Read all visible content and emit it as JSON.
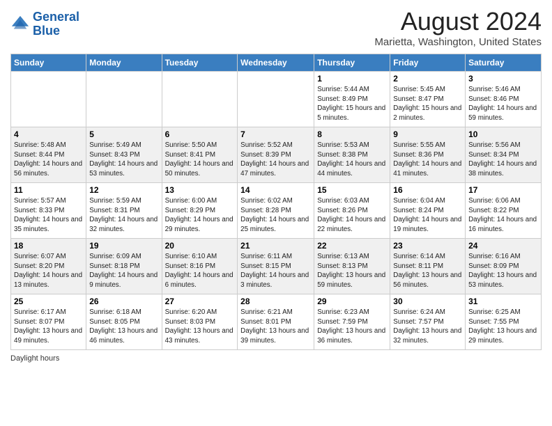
{
  "logo": {
    "line1": "General",
    "line2": "Blue"
  },
  "title": "August 2024",
  "subtitle": "Marietta, Washington, United States",
  "days_of_week": [
    "Sunday",
    "Monday",
    "Tuesday",
    "Wednesday",
    "Thursday",
    "Friday",
    "Saturday"
  ],
  "footer": "Daylight hours",
  "weeks": [
    [
      {
        "day": "",
        "info": ""
      },
      {
        "day": "",
        "info": ""
      },
      {
        "day": "",
        "info": ""
      },
      {
        "day": "",
        "info": ""
      },
      {
        "day": "1",
        "info": "Sunrise: 5:44 AM\nSunset: 8:49 PM\nDaylight: 15 hours and 5 minutes."
      },
      {
        "day": "2",
        "info": "Sunrise: 5:45 AM\nSunset: 8:47 PM\nDaylight: 15 hours and 2 minutes."
      },
      {
        "day": "3",
        "info": "Sunrise: 5:46 AM\nSunset: 8:46 PM\nDaylight: 14 hours and 59 minutes."
      }
    ],
    [
      {
        "day": "4",
        "info": "Sunrise: 5:48 AM\nSunset: 8:44 PM\nDaylight: 14 hours and 56 minutes."
      },
      {
        "day": "5",
        "info": "Sunrise: 5:49 AM\nSunset: 8:43 PM\nDaylight: 14 hours and 53 minutes."
      },
      {
        "day": "6",
        "info": "Sunrise: 5:50 AM\nSunset: 8:41 PM\nDaylight: 14 hours and 50 minutes."
      },
      {
        "day": "7",
        "info": "Sunrise: 5:52 AM\nSunset: 8:39 PM\nDaylight: 14 hours and 47 minutes."
      },
      {
        "day": "8",
        "info": "Sunrise: 5:53 AM\nSunset: 8:38 PM\nDaylight: 14 hours and 44 minutes."
      },
      {
        "day": "9",
        "info": "Sunrise: 5:55 AM\nSunset: 8:36 PM\nDaylight: 14 hours and 41 minutes."
      },
      {
        "day": "10",
        "info": "Sunrise: 5:56 AM\nSunset: 8:34 PM\nDaylight: 14 hours and 38 minutes."
      }
    ],
    [
      {
        "day": "11",
        "info": "Sunrise: 5:57 AM\nSunset: 8:33 PM\nDaylight: 14 hours and 35 minutes."
      },
      {
        "day": "12",
        "info": "Sunrise: 5:59 AM\nSunset: 8:31 PM\nDaylight: 14 hours and 32 minutes."
      },
      {
        "day": "13",
        "info": "Sunrise: 6:00 AM\nSunset: 8:29 PM\nDaylight: 14 hours and 29 minutes."
      },
      {
        "day": "14",
        "info": "Sunrise: 6:02 AM\nSunset: 8:28 PM\nDaylight: 14 hours and 25 minutes."
      },
      {
        "day": "15",
        "info": "Sunrise: 6:03 AM\nSunset: 8:26 PM\nDaylight: 14 hours and 22 minutes."
      },
      {
        "day": "16",
        "info": "Sunrise: 6:04 AM\nSunset: 8:24 PM\nDaylight: 14 hours and 19 minutes."
      },
      {
        "day": "17",
        "info": "Sunrise: 6:06 AM\nSunset: 8:22 PM\nDaylight: 14 hours and 16 minutes."
      }
    ],
    [
      {
        "day": "18",
        "info": "Sunrise: 6:07 AM\nSunset: 8:20 PM\nDaylight: 14 hours and 13 minutes."
      },
      {
        "day": "19",
        "info": "Sunrise: 6:09 AM\nSunset: 8:18 PM\nDaylight: 14 hours and 9 minutes."
      },
      {
        "day": "20",
        "info": "Sunrise: 6:10 AM\nSunset: 8:16 PM\nDaylight: 14 hours and 6 minutes."
      },
      {
        "day": "21",
        "info": "Sunrise: 6:11 AM\nSunset: 8:15 PM\nDaylight: 14 hours and 3 minutes."
      },
      {
        "day": "22",
        "info": "Sunrise: 6:13 AM\nSunset: 8:13 PM\nDaylight: 13 hours and 59 minutes."
      },
      {
        "day": "23",
        "info": "Sunrise: 6:14 AM\nSunset: 8:11 PM\nDaylight: 13 hours and 56 minutes."
      },
      {
        "day": "24",
        "info": "Sunrise: 6:16 AM\nSunset: 8:09 PM\nDaylight: 13 hours and 53 minutes."
      }
    ],
    [
      {
        "day": "25",
        "info": "Sunrise: 6:17 AM\nSunset: 8:07 PM\nDaylight: 13 hours and 49 minutes."
      },
      {
        "day": "26",
        "info": "Sunrise: 6:18 AM\nSunset: 8:05 PM\nDaylight: 13 hours and 46 minutes."
      },
      {
        "day": "27",
        "info": "Sunrise: 6:20 AM\nSunset: 8:03 PM\nDaylight: 13 hours and 43 minutes."
      },
      {
        "day": "28",
        "info": "Sunrise: 6:21 AM\nSunset: 8:01 PM\nDaylight: 13 hours and 39 minutes."
      },
      {
        "day": "29",
        "info": "Sunrise: 6:23 AM\nSunset: 7:59 PM\nDaylight: 13 hours and 36 minutes."
      },
      {
        "day": "30",
        "info": "Sunrise: 6:24 AM\nSunset: 7:57 PM\nDaylight: 13 hours and 32 minutes."
      },
      {
        "day": "31",
        "info": "Sunrise: 6:25 AM\nSunset: 7:55 PM\nDaylight: 13 hours and 29 minutes."
      }
    ]
  ]
}
